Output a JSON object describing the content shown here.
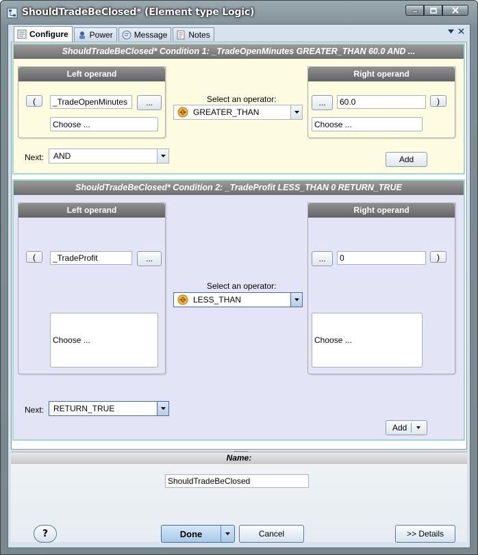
{
  "window": {
    "title": "ShouldTradeBeClosed* (Element type Logic)"
  },
  "tabs": [
    {
      "label": "Configure",
      "icon": "configure-icon",
      "active": true
    },
    {
      "label": "Power",
      "icon": "power-icon",
      "active": false
    },
    {
      "label": "Message",
      "icon": "message-icon",
      "active": false
    },
    {
      "label": "Notes",
      "icon": "notes-icon",
      "active": false
    }
  ],
  "conditions": [
    {
      "header": "ShouldTradeBeClosed*  Condition 1:  _TradeOpenMinutes GREATER_THAN 60.0  AND ...",
      "left_title": "Left operand",
      "right_title": "Right operand",
      "open_paren": "(",
      "close_paren": ")",
      "ellipsis": "...",
      "left_value": "_TradeOpenMinutes",
      "right_value": "60.0",
      "left_choose": "Choose ...",
      "right_choose": "Choose ...",
      "operator_label": "Select an operator:",
      "operator": "GREATER_THAN",
      "next_label": "Next:",
      "next_value": "AND",
      "add_label": "Add"
    },
    {
      "header": "ShouldTradeBeClosed*  Condition 2:  _TradeProfit LESS_THAN 0  RETURN_TRUE",
      "left_title": "Left operand",
      "right_title": "Right operand",
      "open_paren": "(",
      "close_paren": ")",
      "ellipsis": "...",
      "left_value": "_TradeProfit",
      "right_value": "0",
      "left_choose": "Choose ...",
      "right_choose": "Choose ...",
      "operator_label": "Select an operator:",
      "operator": "LESS_THAN",
      "next_label": "Next:",
      "next_value": "RETURN_TRUE",
      "add_label": "Add"
    }
  ],
  "name_panel": {
    "header": "Name:",
    "value": "ShouldTradeBeClosed"
  },
  "footer": {
    "help_label": "?",
    "done_label": "Done",
    "cancel_label": "Cancel",
    "details_label": ">> Details"
  },
  "colors": {
    "condition1_bg": "#fdfbe0",
    "condition2_bg": "#e3e5f7",
    "condition_border": "#9fd9c9",
    "header_gray": "#7a7a7a",
    "window_frame": "#8a979e"
  }
}
